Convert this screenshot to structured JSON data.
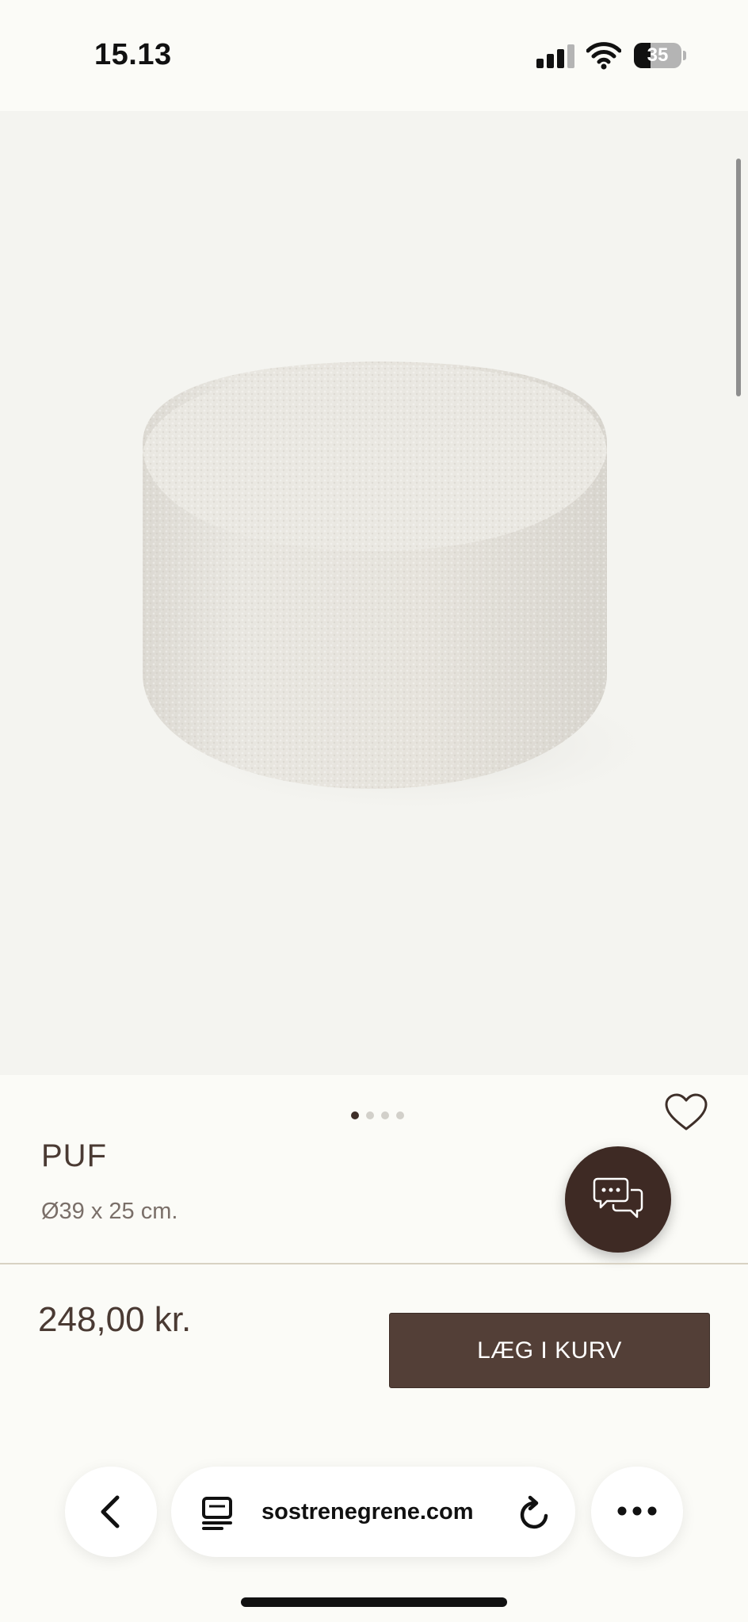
{
  "status_bar": {
    "time": "15.13",
    "battery_level": "35",
    "battery_fraction": 0.35
  },
  "product": {
    "image_icon": "ottoman-pouf-image",
    "carousel": {
      "total": 4,
      "active_index": 0
    },
    "title": "PUF",
    "dimensions": "Ø39 x 25 cm.",
    "price": "248,00 kr.",
    "add_to_cart_label": "LÆG I KURV",
    "favorite_icon": "heart-outline-icon",
    "chat_icon": "chat-bubbles-icon"
  },
  "browser": {
    "url": "sostrenegrene.com",
    "back_icon": "chevron-left-icon",
    "tabs_icon": "page-tabs-icon",
    "reload_icon": "reload-icon",
    "more_icon": "more-dots-icon"
  },
  "colors": {
    "brand_dark": "#533f37",
    "chat_button": "#3e2a24",
    "text": "#4a3a33",
    "page_bg": "#fbfbf7",
    "image_bg": "#f4f4f0"
  }
}
